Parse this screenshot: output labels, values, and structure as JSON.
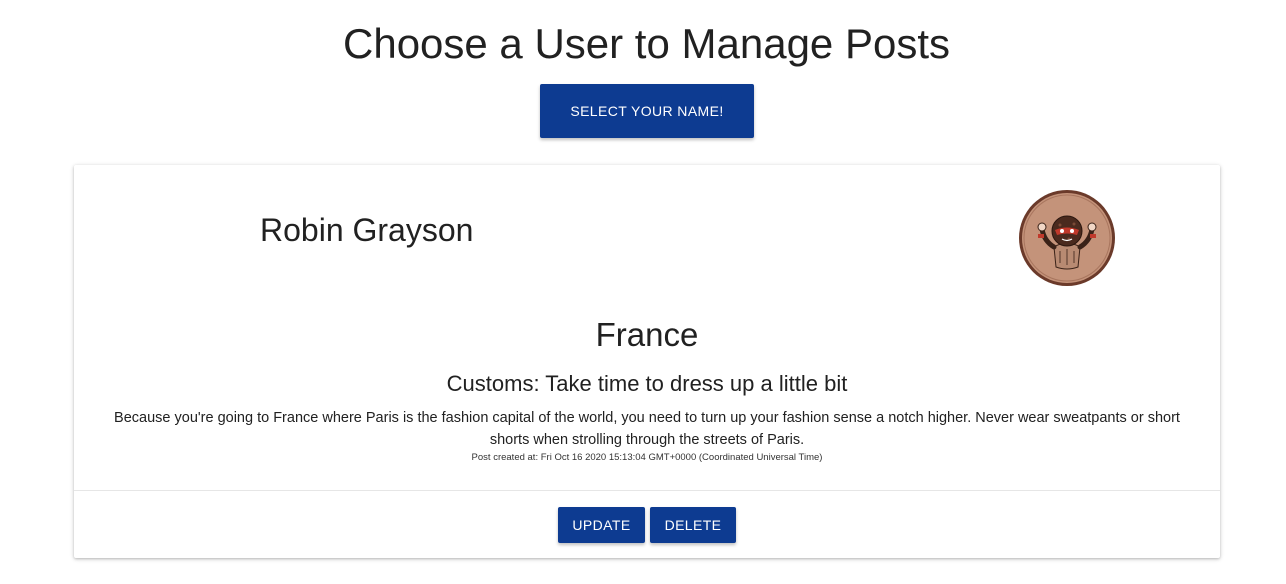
{
  "header": {
    "title": "Choose a User to Manage Posts",
    "select_button_label": "SELECT YOUR NAME!"
  },
  "post": {
    "author": "Robin Grayson",
    "avatar_icon": "robin-avatar-icon",
    "location": "France",
    "title": "Customs: Take time to dress up a little bit",
    "body": "Because you're going to France where Paris is the fashion capital of the world, you need to turn up your fashion sense a notch higher. Never wear sweatpants or short shorts when strolling through the streets of Paris.",
    "created_at": "Post created at: Fri Oct 16 2020 15:13:04 GMT+0000 (Coordinated Universal Time)",
    "actions": {
      "update_label": "UPDATE",
      "delete_label": "DELETE"
    }
  },
  "colors": {
    "primary": "#0d3b91",
    "text": "#212121",
    "avatar_bg": "#c4937a",
    "avatar_border": "#6b3a2a"
  }
}
